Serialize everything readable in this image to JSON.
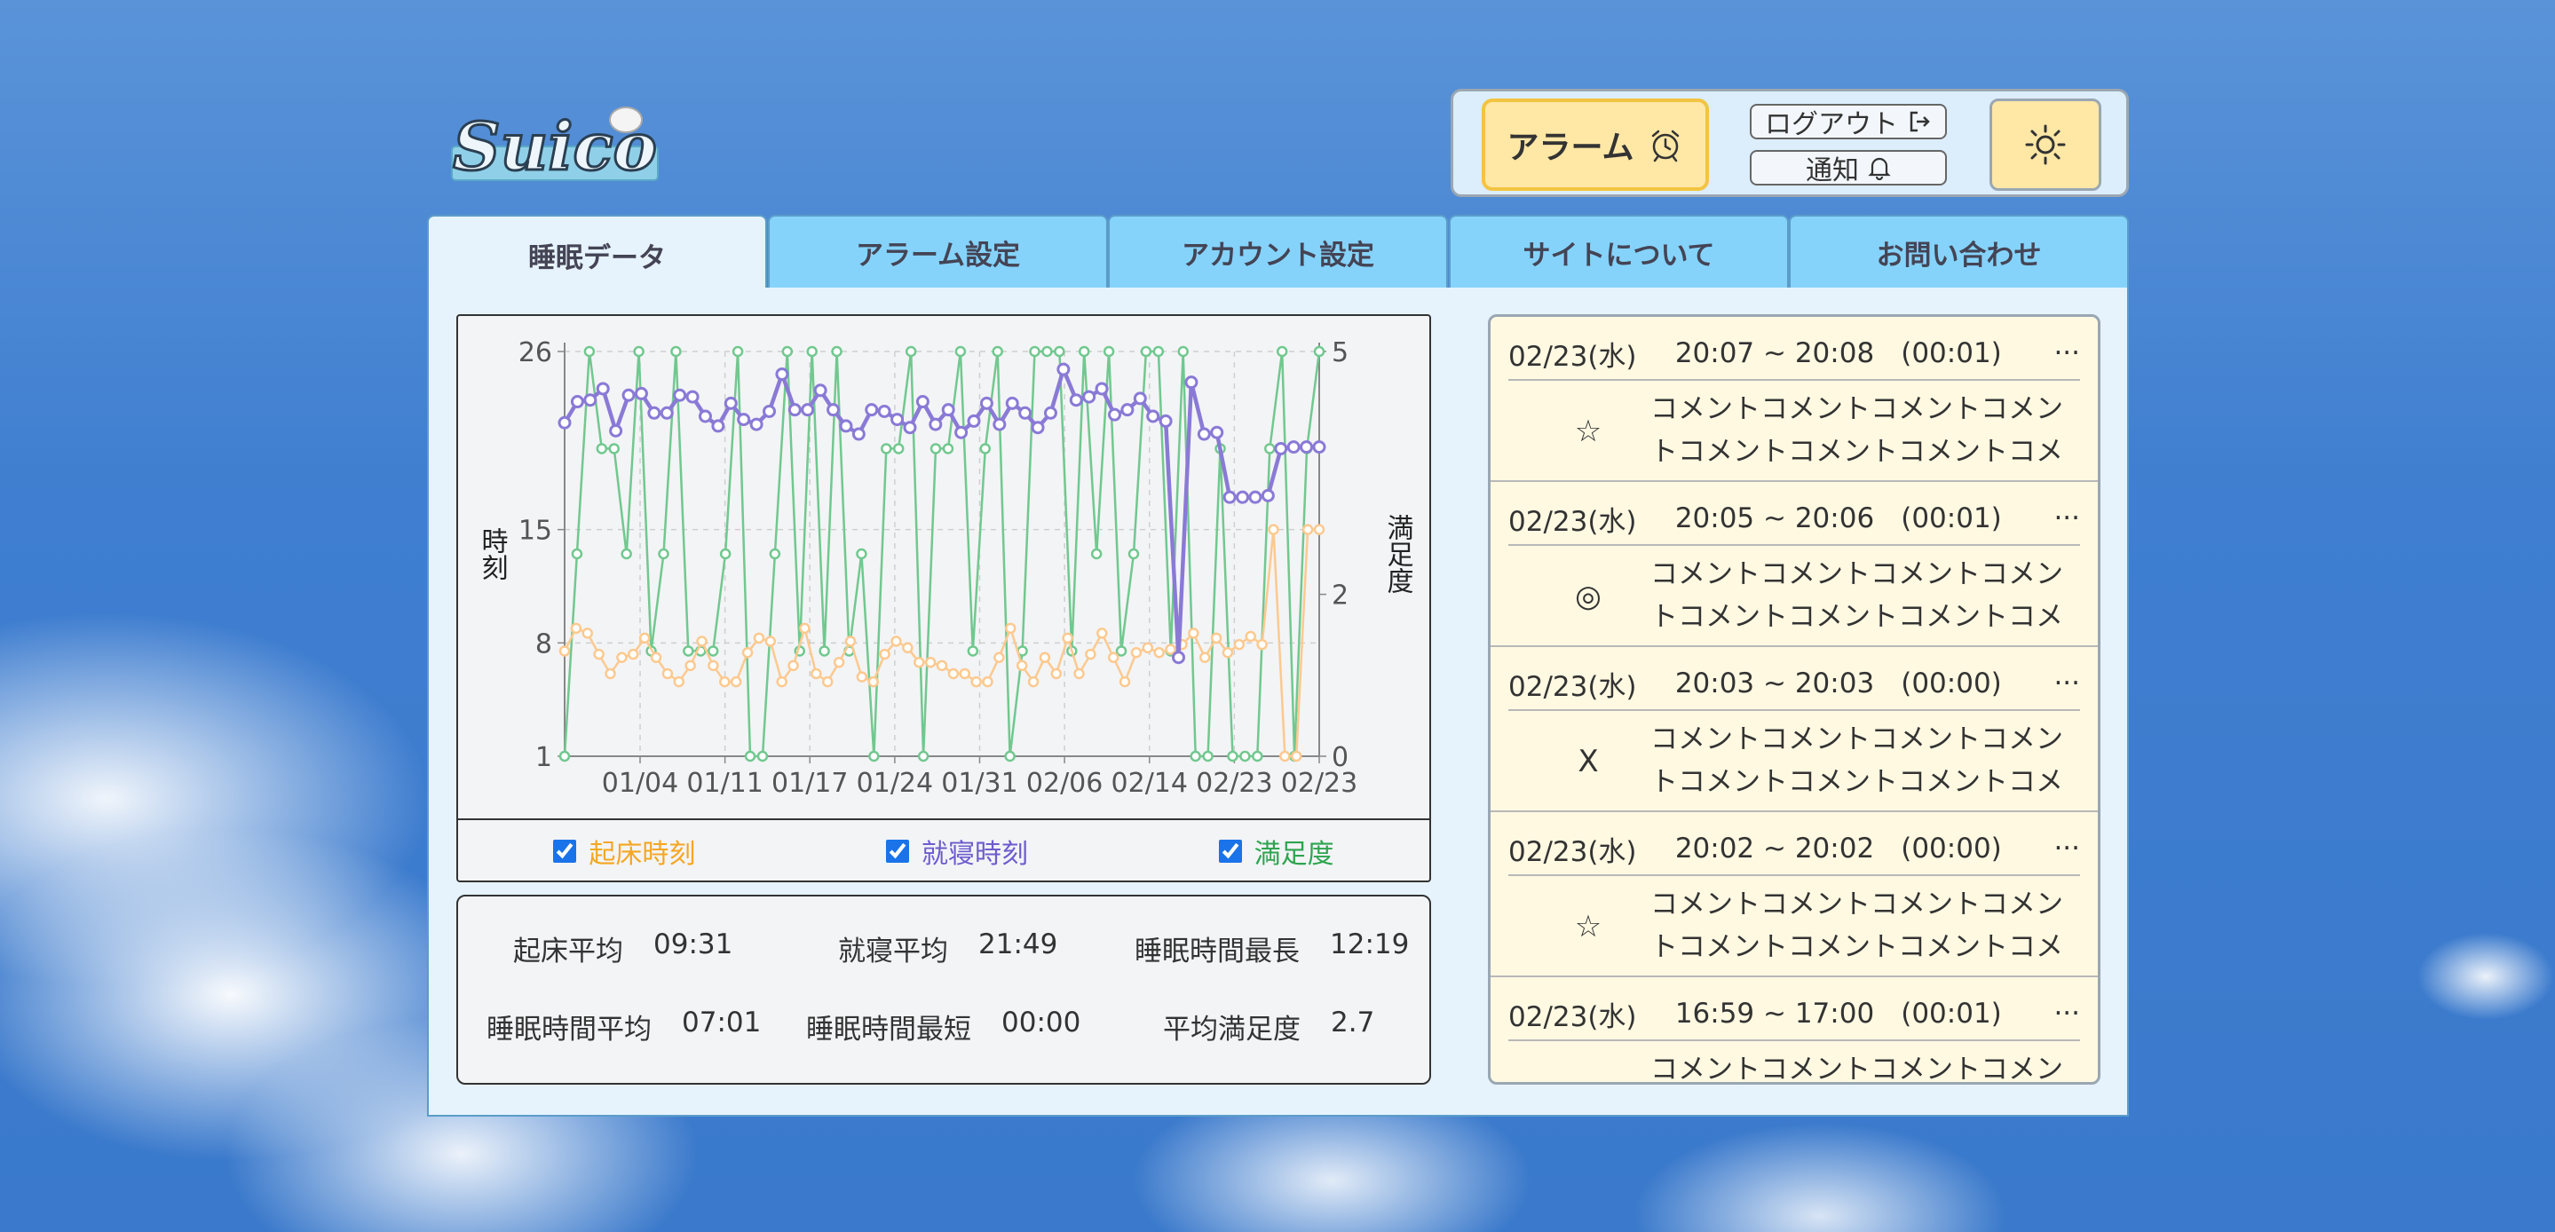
{
  "app": {
    "logo_text": "Suico"
  },
  "header": {
    "alarm_label": "アラーム",
    "logout_label": "ログアウト",
    "notice_label": "通知",
    "theme_icon": "sun-icon"
  },
  "tabs": [
    {
      "label": "睡眠データ",
      "active": true
    },
    {
      "label": "アラーム設定",
      "active": false
    },
    {
      "label": "アカウント設定",
      "active": false
    },
    {
      "label": "サイトについて",
      "active": false
    },
    {
      "label": "お問い合わせ",
      "active": false
    }
  ],
  "chart_data": {
    "type": "line",
    "ylabel": "時刻",
    "y2label": "満足度",
    "y_ticks": [
      "26",
      "15",
      "8",
      "1"
    ],
    "y2_ticks": [
      "5",
      "2",
      "0"
    ],
    "ylim": [
      1,
      26
    ],
    "y2lim": [
      0,
      5
    ],
    "x_ticks": [
      "01/04",
      "01/11",
      "01/17",
      "01/24",
      "01/31",
      "02/06",
      "02/14",
      "02/23",
      "02/23"
    ],
    "grid": true,
    "series": [
      {
        "name": "起床時刻",
        "color": "#fcc98f",
        "axis": "left",
        "values": [
          7.5,
          8.9,
          8.6,
          7.3,
          6.1,
          7.1,
          7.3,
          8.3,
          7.1,
          6.1,
          5.6,
          6.6,
          8.1,
          6.6,
          5.6,
          5.6,
          7.4,
          8.3,
          8.1,
          5.6,
          6.6,
          8.9,
          6.1,
          5.6,
          6.8,
          8.1,
          5.9,
          5.6,
          7.3,
          8.1,
          7.7,
          6.8,
          6.8,
          6.6,
          6.1,
          6.1,
          5.6,
          5.6,
          7.1,
          8.9,
          6.6,
          5.6,
          7.1,
          6.1,
          8.3,
          6.1,
          7.3,
          8.6,
          7.1,
          5.6,
          7.4,
          7.7,
          7.4,
          7.6,
          7.9,
          8.6,
          7.1,
          8.3,
          7.4,
          7.9,
          8.4,
          7.9,
          15,
          1.0,
          1.0,
          15,
          15
        ]
      },
      {
        "name": "就寝時刻",
        "color": "#8a7ad6",
        "axis": "left",
        "values": [
          21.6,
          22.9,
          23.0,
          23.7,
          21.1,
          23.3,
          23.4,
          22.2,
          22.2,
          23.3,
          23.2,
          22.0,
          21.4,
          22.8,
          21.8,
          21.5,
          22.3,
          24.6,
          22.4,
          22.4,
          23.6,
          22.4,
          21.4,
          20.9,
          22.4,
          22.3,
          21.8,
          21.3,
          22.9,
          21.5,
          22.4,
          21.0,
          21.7,
          22.8,
          21.5,
          22.8,
          22.2,
          21.3,
          22.2,
          24.9,
          23.0,
          23.2,
          23.7,
          22.1,
          22.4,
          23.1,
          22.0,
          21.7,
          7.1,
          24.1,
          20.9,
          21.0,
          17.0,
          17.0,
          17.0,
          17.1,
          20.0,
          20.1,
          20.1,
          20.1
        ]
      },
      {
        "name": "満足度",
        "color": "#71c88f",
        "axis": "right",
        "values": [
          0,
          2.5,
          5,
          3.8,
          3.8,
          2.5,
          5,
          1.3,
          2.5,
          5,
          1.3,
          1.3,
          1.3,
          2.5,
          5,
          0,
          0,
          2.5,
          5,
          1.3,
          5,
          1.3,
          5,
          1.3,
          2.5,
          0,
          3.8,
          3.8,
          5,
          0,
          3.8,
          3.8,
          5,
          1.3,
          3.8,
          5,
          0,
          1.3,
          5,
          5,
          5,
          1.3,
          5,
          2.5,
          5,
          1.3,
          2.5,
          5,
          5,
          1.3,
          5,
          0,
          0,
          3.8,
          0,
          0,
          0,
          3.8,
          5,
          0,
          3.8,
          5
        ]
      }
    ]
  },
  "legend": [
    {
      "label": "起床時刻",
      "checked": true,
      "color": "#f5a623"
    },
    {
      "label": "就寝時刻",
      "checked": true,
      "color": "#6c5ccf"
    },
    {
      "label": "満足度",
      "checked": true,
      "color": "#2ea44f"
    }
  ],
  "stats": {
    "wake_avg_label": "起床平均",
    "wake_avg": "09:31",
    "sleep_avg_label": "就寝平均",
    "sleep_avg": "21:49",
    "dur_max_label": "睡眠時間最長",
    "dur_max": "12:19",
    "dur_avg_label": "睡眠時間平均",
    "dur_avg": "07:01",
    "dur_min_label": "睡眠時間最短",
    "dur_min": "00:00",
    "sat_avg_label": "平均満足度",
    "sat_avg": "2.7"
  },
  "records": [
    {
      "date": "02/23(水)",
      "time": "20:07 ~ 20:08",
      "duration": "(00:01)",
      "more": "···",
      "mark": "☆",
      "comment": "コメントコメントコメントコメントコメントコメントコメントコメントコメント"
    },
    {
      "date": "02/23(水)",
      "time": "20:05 ~ 20:06",
      "duration": "(00:01)",
      "more": "···",
      "mark": "◎",
      "comment": "コメントコメントコメントコメントコメントコメントコメントコメントコメント"
    },
    {
      "date": "02/23(水)",
      "time": "20:03 ~ 20:03",
      "duration": "(00:00)",
      "more": "···",
      "mark": "X",
      "comment": "コメントコメントコメントコメントコメントコメントコメントコメントコメント"
    },
    {
      "date": "02/23(水)",
      "time": "20:02 ~ 20:02",
      "duration": "(00:00)",
      "more": "···",
      "mark": "☆",
      "comment": "コメントコメントコメントコメントコメントコメントコメントコメントコメント"
    },
    {
      "date": "02/23(水)",
      "time": "16:59 ~ 17:00",
      "duration": "(00:01)",
      "more": "···",
      "mark": "◎",
      "comment": "コメントコメントコメントコメントコメントコメントコメントコメントコメント"
    }
  ]
}
